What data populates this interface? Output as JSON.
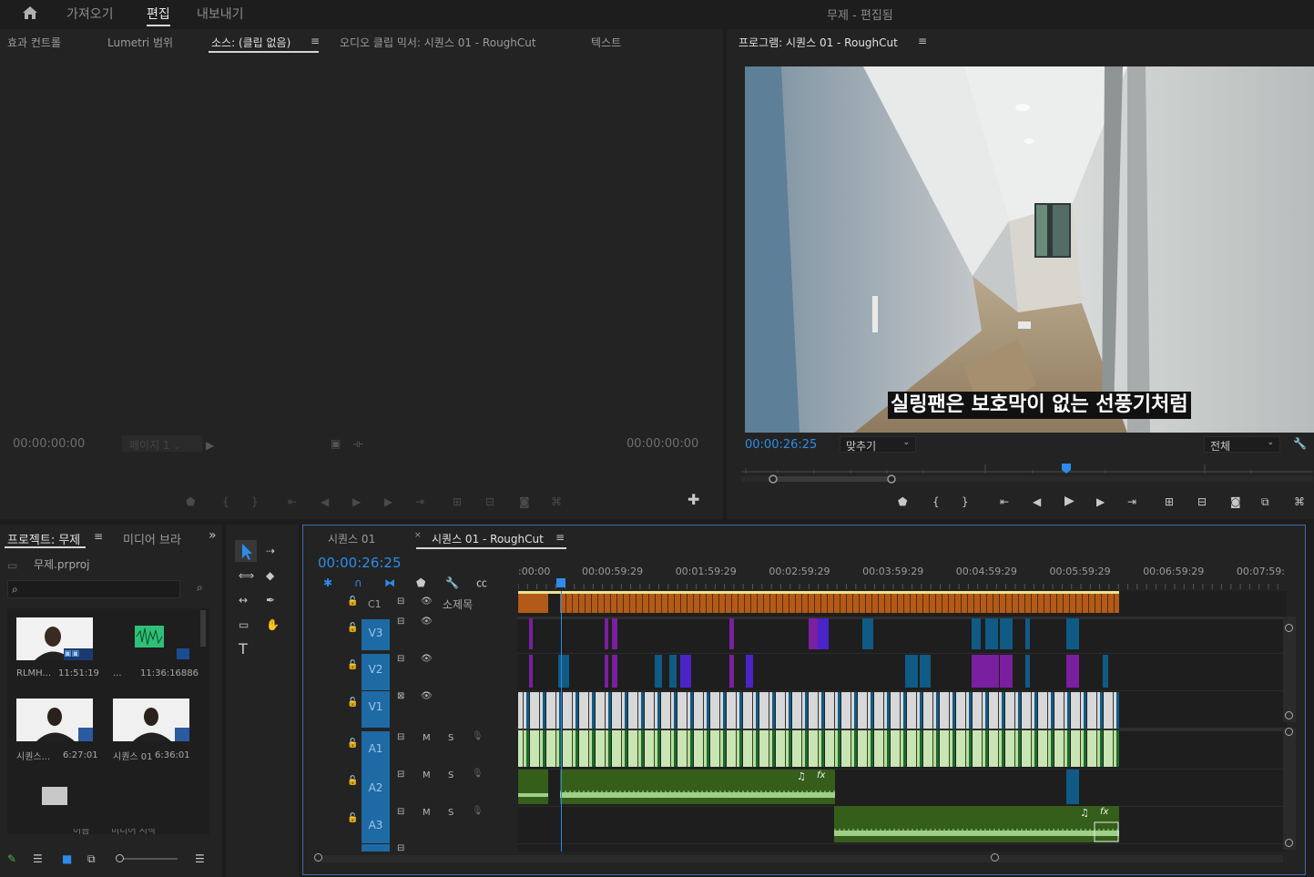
{
  "topbar": {
    "home_icon": "home-icon",
    "tabs": [
      {
        "label": "가져오기"
      },
      {
        "label": "편집"
      },
      {
        "label": "내보내기"
      }
    ],
    "title": "무제 - 편집됨"
  },
  "source_panel": {
    "tabs": [
      {
        "label": "효과 컨트롤"
      },
      {
        "label": "Lumetri 범위"
      },
      {
        "label": "소스: (클립 없음)"
      },
      {
        "label": "오디오 클립 믹서: 시퀀스 01 - RoughCut"
      },
      {
        "label": "텍스트"
      }
    ],
    "menu_icon": "≡",
    "timecode_left": "00:00:00:00",
    "page_select": "페이지 1",
    "timecode_right": "00:00:00:00"
  },
  "program_panel": {
    "title": "프로그램: 시퀀스 01 - RoughCut",
    "menu_icon": "≡",
    "subtitle": "실링팬은 보호막이 없는 선풍기처럼",
    "timecode": "00:00:26:25",
    "fit_select": "맞추기",
    "quality_select": "전체"
  },
  "project_panel": {
    "tabs": [
      {
        "label": "프로젝트: 무제"
      },
      {
        "label": "미디어 브라"
      }
    ],
    "menu_icon": "≡",
    "more_icon": "»",
    "filename": "무제.prproj",
    "search_placeholder": "",
    "items": [
      {
        "name": "RLMH...",
        "duration": "11:51:19",
        "kind": "video"
      },
      {
        "name": "...",
        "duration": "11:36:16886",
        "kind": "audio"
      },
      {
        "name": "시퀀스...",
        "duration": "6:27:01",
        "kind": "sequence"
      },
      {
        "name": "시퀀스 01",
        "duration": "6:36:01",
        "kind": "sequence"
      }
    ],
    "bin_icon": "folder-icon",
    "cut_labels": [
      "이름",
      "미디어 시작"
    ]
  },
  "timeline": {
    "tabs": [
      {
        "label": "시퀀스 01"
      },
      {
        "label": "시퀀스 01 - RoughCut"
      }
    ],
    "close_icon": "×",
    "menu_icon": "≡",
    "timecode": "00:00:26:25",
    "ruler": [
      ":00:00",
      "00:00:59:29",
      "00:01:59:29",
      "00:02:59:29",
      "00:03:59:29",
      "00:04:59:29",
      "00:05:59:29",
      "00:06:59:29",
      "00:07:59:"
    ],
    "caption_track": {
      "label": "C1",
      "name": "소제목"
    },
    "video_tracks": [
      {
        "label": "V3"
      },
      {
        "label": "V2"
      },
      {
        "label": "V1"
      }
    ],
    "audio_tracks": [
      {
        "label": "A1"
      },
      {
        "label": "A2"
      },
      {
        "label": "A3"
      }
    ],
    "mute": "M",
    "solo": "S",
    "fx": "fx",
    "note": "♫",
    "playhead_fraction": 0.056
  },
  "colors": {
    "accent": "#2d8ceb",
    "panel_bg": "#232323",
    "track_label": "#1e6aa5",
    "video_clip": "#d3d3d3",
    "video_clip_blue": "#0f5b85",
    "purple_clip": "#7a1fa0",
    "audio_clip": "#355e1a",
    "audio_clip_light": "#b9dca0",
    "caption_clip": "#b35a18"
  }
}
